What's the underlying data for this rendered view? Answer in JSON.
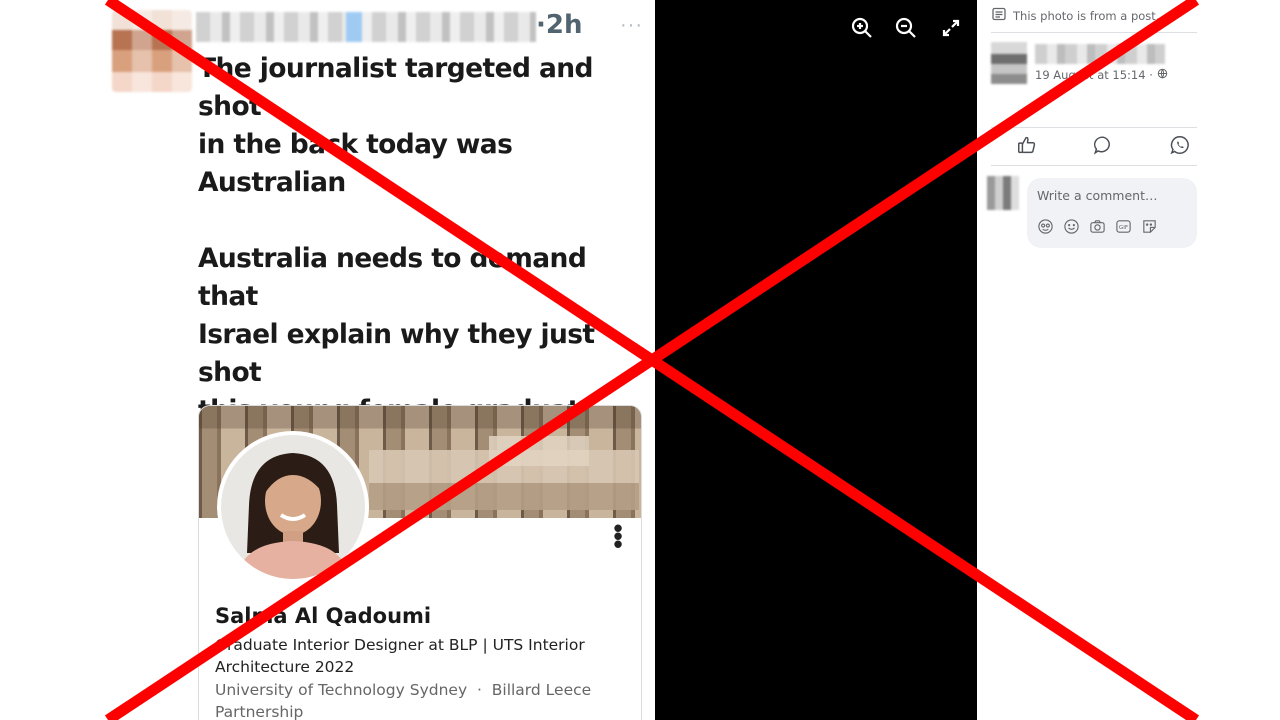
{
  "tweet": {
    "time": "·2h",
    "more": "···",
    "text": "The journalist targeted and shot\nin the back today was\nAustralian\n\nAustralia needs to demand that\nIsrael explain why they just shot\nthis young female graduate\nfrom Sydney wearing a PRESS\nvest in Gaza?"
  },
  "profile_card": {
    "name": "Salma Al Qadoumi",
    "headline": "Graduate Interior Designer at BLP | UTS Interior Architecture 2022",
    "education": "University of Technology Sydney  ·  Billard Leece Partnership",
    "menu_icon": "vertical-dots-icon"
  },
  "viewer": {
    "buttons": [
      "zoom-in-icon",
      "zoom-out-icon",
      "fullscreen-icon"
    ],
    "background": "#000000"
  },
  "sidebar": {
    "post_note": "This photo is from a post.",
    "post_date": "19 August at 15:14 ·",
    "actions": [
      "like-icon",
      "comment-icon",
      "whatsapp-icon"
    ],
    "comment_placeholder": "Write a comment…",
    "comment_tools": [
      "avatar-sticker-icon",
      "emoji-icon",
      "camera-icon",
      "gif-icon",
      "sticker-icon"
    ]
  },
  "overlay": {
    "type": "red-cross",
    "color": "#ff0000"
  }
}
